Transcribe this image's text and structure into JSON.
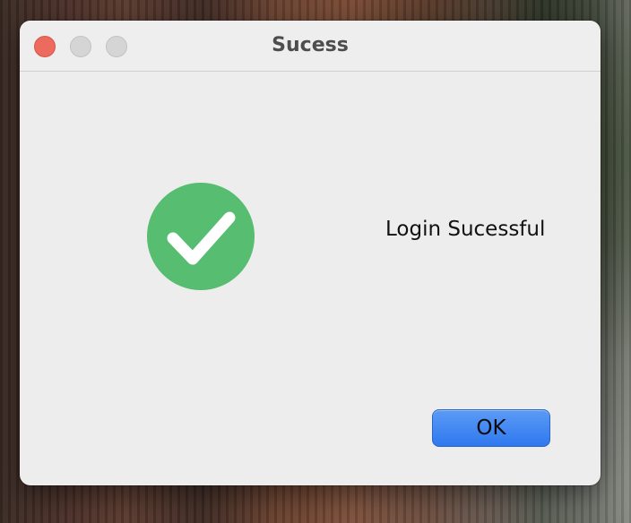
{
  "window": {
    "title": "Sucess",
    "traffic_lights": {
      "close_color": "#ed6a5e",
      "minimize_color": "#d6d5d5",
      "maximize_color": "#d6d5d5"
    }
  },
  "content": {
    "icon": "checkmark-circle-icon",
    "icon_color": "#56bd71",
    "message": "Login Sucessful"
  },
  "buttons": {
    "ok_label": "OK",
    "ok_color": "#3b82f6"
  }
}
